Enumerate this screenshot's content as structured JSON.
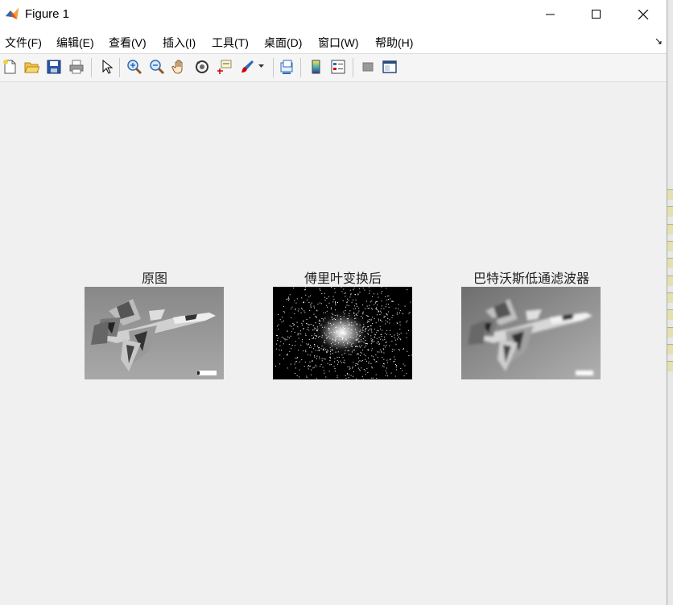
{
  "window": {
    "title": "Figure 1",
    "icon": "matlab-logo-icon"
  },
  "title_buttons": [
    "minimize-icon",
    "maximize-icon",
    "close-icon"
  ],
  "menu": {
    "items": [
      "文件(F)",
      "编辑(E)",
      "查看(V)",
      "插入(I)",
      "工具(T)",
      "桌面(D)",
      "窗口(W)",
      "帮助(H)"
    ],
    "overflow_arrow": "↘"
  },
  "toolbar": {
    "icons": [
      "new-figure-icon",
      "open-file-icon",
      "save-icon",
      "print-icon",
      "select-pointer-icon",
      "zoom-in-icon",
      "zoom-out-icon",
      "pan-hand-icon",
      "rotate-3d-icon",
      "data-cursor-icon",
      "brush-icon",
      "brush-dropdown-icon",
      "link-plot-icon",
      "colorbar-icon",
      "legend-icon",
      "hide-plot-tools-icon",
      "show-plot-tools-icon"
    ]
  },
  "axes": [
    {
      "title": "原图",
      "image": "original-jet-grayscale"
    },
    {
      "title": "傅里叶变换后",
      "image": "fourier-spectrum-noise"
    },
    {
      "title": "巴特沃斯低通滤波器",
      "image": "butterworth-lowpass-blurred-jet"
    }
  ],
  "colors": {
    "figure_bg": "#f0f0f0",
    "titlebar_bg": "#ffffff",
    "toolbar_bg": "#f5f5f5"
  }
}
